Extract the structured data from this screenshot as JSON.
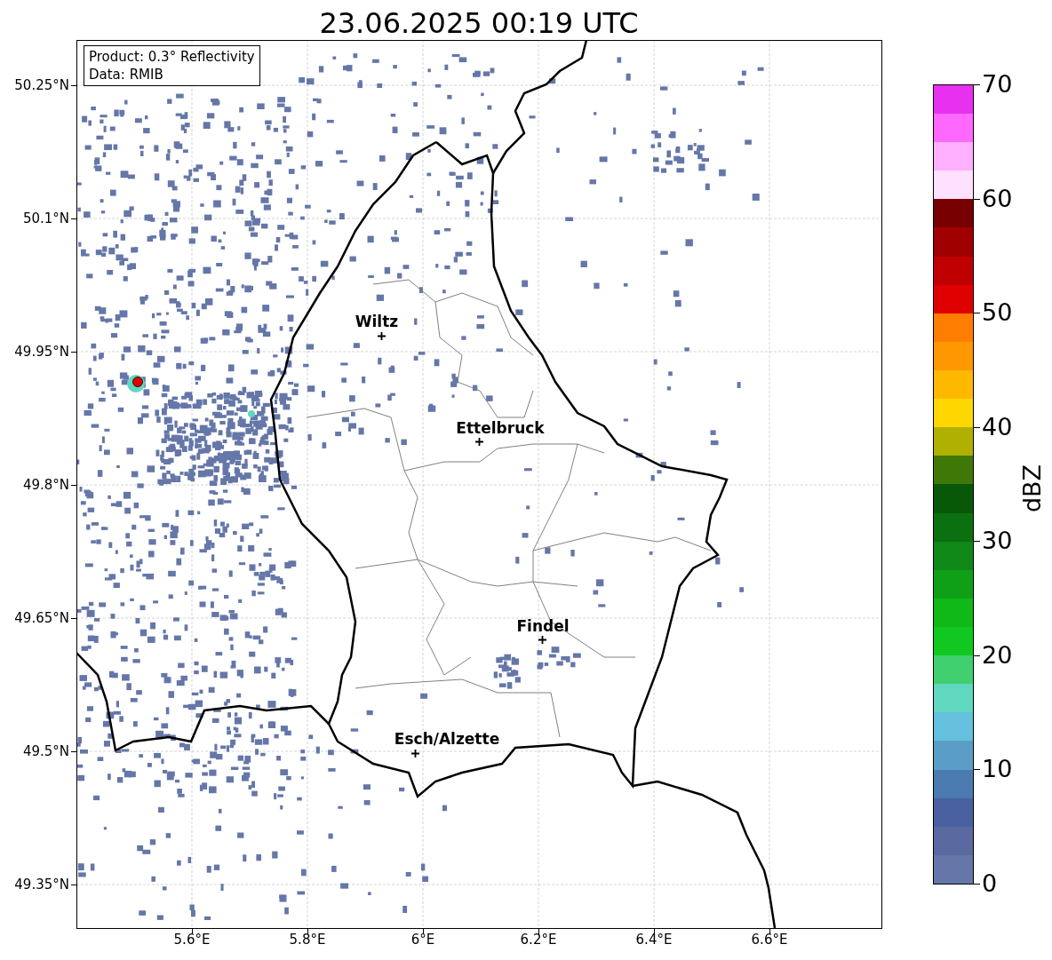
{
  "title": "23.06.2025 00:19 UTC",
  "info_box": [
    "Product: 0.3° Reflectivity",
    "Data: RMIB"
  ],
  "y_ticks": [
    "50.25°N",
    "50.1°N",
    "49.95°N",
    "49.8°N",
    "49.65°N",
    "49.5°N",
    "49.35°N"
  ],
  "x_ticks": [
    "5.6°E",
    "5.8°E",
    "6°E",
    "6.2°E",
    "6.4°E",
    "6.6°E"
  ],
  "places": [
    {
      "label": "Wiltz"
    },
    {
      "label": "Ettelbruck"
    },
    {
      "label": "Findel"
    },
    {
      "label": "Esch/Alzette"
    }
  ],
  "colorbar": {
    "label": "dBZ",
    "ticks": [
      "70",
      "60",
      "50",
      "40",
      "30",
      "20",
      "10",
      "0"
    ],
    "segments": [
      {
        "color": "#6577a8"
      },
      {
        "color": "#5a6aa0"
      },
      {
        "color": "#4860a0"
      },
      {
        "color": "#4a7ab0"
      },
      {
        "color": "#5a9ec8"
      },
      {
        "color": "#64c0dc"
      },
      {
        "color": "#60d8c0"
      },
      {
        "color": "#40d070"
      },
      {
        "color": "#10c820"
      },
      {
        "color": "#10b818"
      },
      {
        "color": "#10a018"
      },
      {
        "color": "#108818"
      },
      {
        "color": "#0a7010"
      },
      {
        "color": "#085808"
      },
      {
        "color": "#407808"
      },
      {
        "color": "#b0b000"
      },
      {
        "color": "#ffd700"
      },
      {
        "color": "#ffb800"
      },
      {
        "color": "#ff9800"
      },
      {
        "color": "#ff7d00"
      },
      {
        "color": "#e00000"
      },
      {
        "color": "#c00000"
      },
      {
        "color": "#a00000"
      },
      {
        "color": "#780000"
      },
      {
        "color": "#ffe0ff"
      },
      {
        "color": "#ffb0ff"
      },
      {
        "color": "#ff68ff"
      },
      {
        "color": "#e830f0"
      }
    ]
  }
}
